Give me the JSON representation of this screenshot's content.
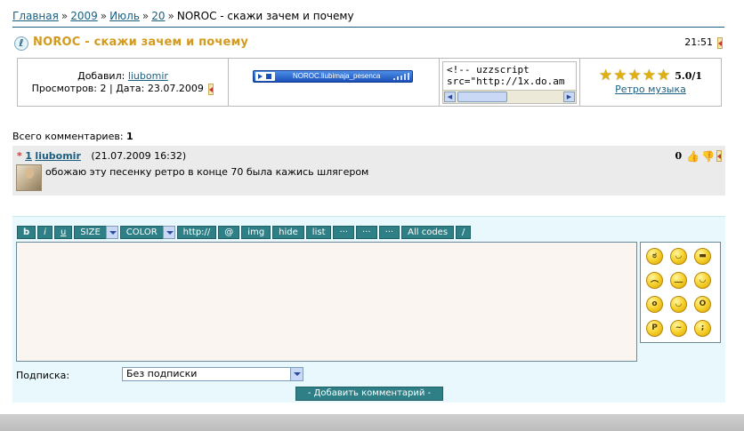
{
  "breadcrumb": [
    {
      "label": "Главная"
    },
    {
      "label": "2009"
    },
    {
      "label": "Июль"
    },
    {
      "label": "20"
    }
  ],
  "breadcrumb_separator": "»",
  "breadcrumb_current": "NOROC - скажи зачем и почему",
  "entry": {
    "title": "NOROC - скажи зачем и почему",
    "time": "21:51",
    "added_by_label": "Добавил:",
    "author": "liubomir",
    "views_line": "Просмотров: 2 | Дата: 23.07.2009",
    "player_title": "NOROC.liubimaja_pesenca",
    "code_snippet": "<!-- uzzscript\nsrc=\"http://1x.do.am",
    "rating_value": "5.0/1",
    "rating_stars": 5,
    "category": "Ретро музыка"
  },
  "comments": {
    "total_label": "Всего комментариев:",
    "total_count": "1",
    "items": [
      {
        "number": "1",
        "author": "liubomir",
        "date": "(21.07.2009 16:32)",
        "text": "обожаю эту песенку ретро в конце 70 была кажись шлягером",
        "rating": "0"
      }
    ]
  },
  "form": {
    "toolbar": [
      "b",
      "i",
      "u",
      "SIZE",
      "COLOR",
      "http://",
      "@",
      "img",
      "hide",
      "list",
      "···",
      "···",
      "···",
      "All codes",
      "/"
    ],
    "message_value": "",
    "subscription_label": "Подписка:",
    "subscription_value": "Без подписки",
    "submit_label": "- Добавить комментарий -",
    "smileys": [
      "angry",
      "grin",
      "cool",
      "sad",
      "sleepy",
      "smile",
      "surprised",
      "happy",
      "shocked",
      "tongue",
      "confused",
      "wink"
    ]
  },
  "colors": {
    "link": "#1a5f80",
    "title": "#d49a1e",
    "button": "#2f7f86",
    "form_bg": "#e8f8fc",
    "comment_bg": "#ebebeb"
  }
}
